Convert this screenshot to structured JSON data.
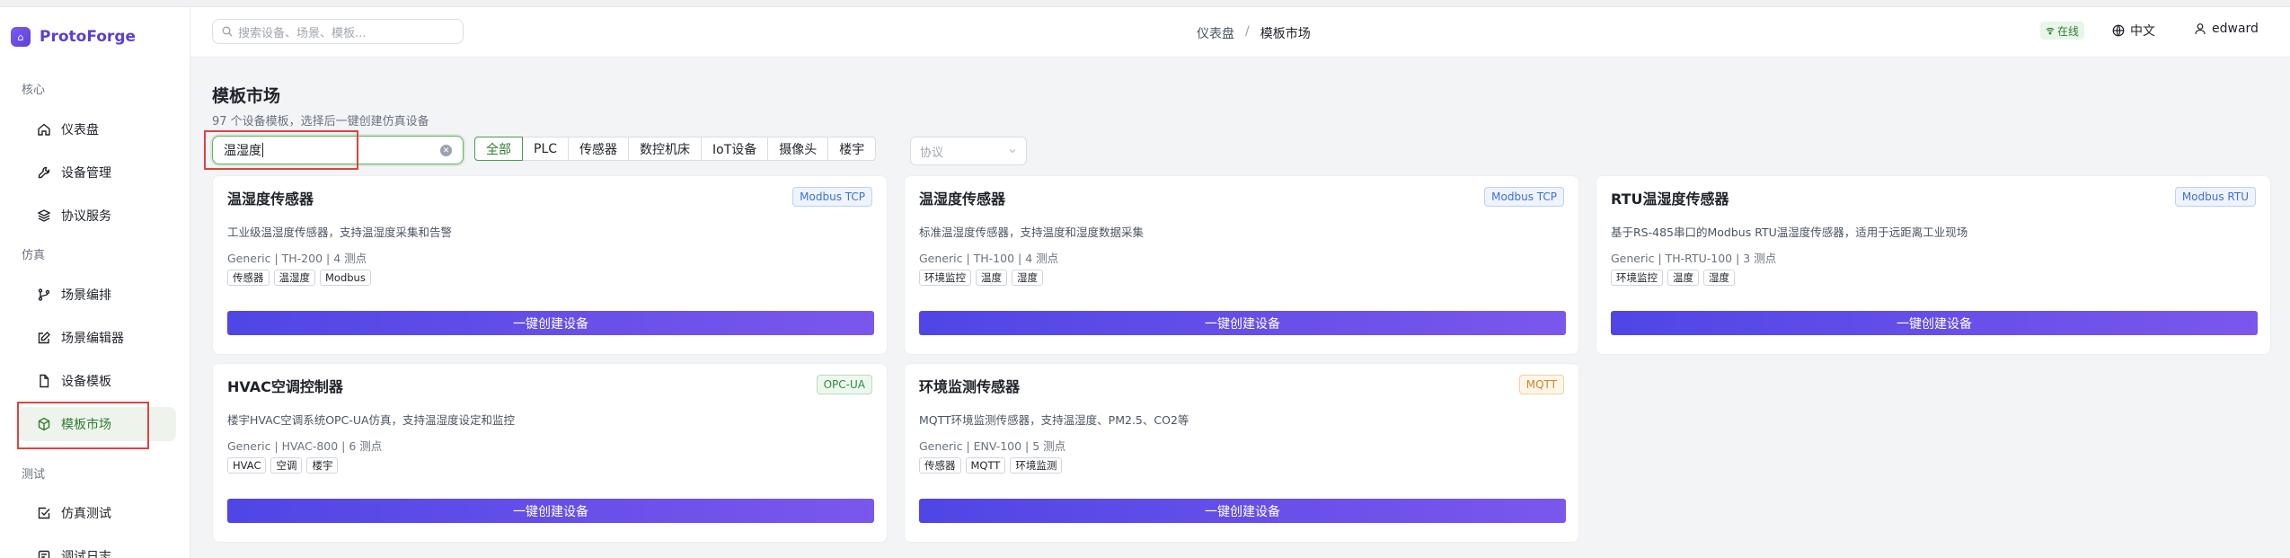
{
  "app": {
    "name": "ProtoForge",
    "logo_glyph": "⌂"
  },
  "header": {
    "search_placeholder": "搜索设备、场景、模板...",
    "breadcrumb": [
      "仪表盘",
      "模板市场"
    ],
    "breadcrumb_sep": "/",
    "status": "在线",
    "language": "中文",
    "user": "edward"
  },
  "sidebar": {
    "groups": [
      {
        "label": "核心",
        "items": [
          {
            "label": "仪表盘",
            "icon": "home-icon"
          },
          {
            "label": "设备管理",
            "icon": "wrench-icon"
          },
          {
            "label": "协议服务",
            "icon": "layers-icon"
          }
        ]
      },
      {
        "label": "仿真",
        "items": [
          {
            "label": "场景编排",
            "icon": "branch-icon"
          },
          {
            "label": "场景编辑器",
            "icon": "edit-icon"
          },
          {
            "label": "设备模板",
            "icon": "file-icon"
          },
          {
            "label": "模板市场",
            "icon": "cube-icon",
            "active": true
          }
        ]
      },
      {
        "label": "测试",
        "items": [
          {
            "label": "仿真测试",
            "icon": "check-square-icon"
          },
          {
            "label": "调试日志",
            "icon": "log-icon"
          }
        ]
      }
    ]
  },
  "main": {
    "title": "模板市场",
    "subtitle": "97 个设备模板，选择后一键创建仿真设备",
    "filter_value": "温湿度",
    "categories": [
      "全部",
      "PLC",
      "传感器",
      "数控机床",
      "IoT设备",
      "摄像头",
      "楼宇"
    ],
    "active_category": "全部",
    "protocol_placeholder": "协议",
    "create_label": "一键创建设备",
    "cards": [
      {
        "title": "温湿度传感器",
        "protocol": "Modbus TCP",
        "desc": "工业级温湿度传感器，支持温湿度采集和告警",
        "meta": "Generic | TH-200 | 4 测点",
        "tags": [
          "传感器",
          "温湿度",
          "Modbus"
        ]
      },
      {
        "title": "温湿度传感器",
        "protocol": "Modbus TCP",
        "desc": "标准温湿度传感器，支持温度和湿度数据采集",
        "meta": "Generic | TH-100 | 4 测点",
        "tags": [
          "环境监控",
          "温度",
          "湿度"
        ]
      },
      {
        "title": "RTU温湿度传感器",
        "protocol": "Modbus RTU",
        "desc": "基于RS-485串口的Modbus RTU温湿度传感器，适用于远距离工业现场",
        "meta": "Generic | TH-RTU-100 | 3 测点",
        "tags": [
          "环境监控",
          "温度",
          "湿度"
        ]
      },
      {
        "title": "HVAC空调控制器",
        "protocol": "OPC-UA",
        "desc": "楼宇HVAC空调系统OPC-UA仿真，支持温湿度设定和监控",
        "meta": "Generic | HVAC-800 | 6 测点",
        "tags": [
          "HVAC",
          "空调",
          "楼宇"
        ]
      },
      {
        "title": "环境监测传感器",
        "protocol": "MQTT",
        "desc": "MQTT环境监测传感器，支持温湿度、PM2.5、CO2等",
        "meta": "Generic | ENV-100 | 5 测点",
        "tags": [
          "传感器",
          "MQTT",
          "环境监测"
        ]
      }
    ]
  },
  "colors": {
    "accent": "#5b3fd6",
    "active_green": "#2f7d32",
    "annotation_red": "#e0433f"
  }
}
